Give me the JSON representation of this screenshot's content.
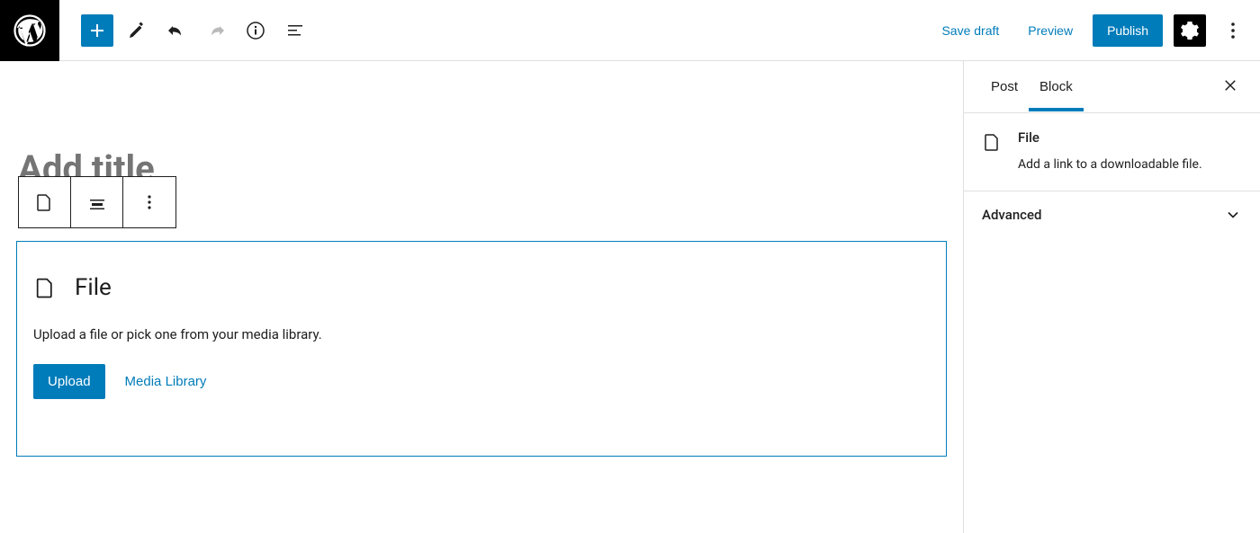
{
  "toolbar": {
    "save_draft": "Save draft",
    "preview": "Preview",
    "publish": "Publish"
  },
  "editor": {
    "title_placeholder": "Add title",
    "file_block": {
      "title": "File",
      "description": "Upload a file or pick one from your media library.",
      "upload_label": "Upload",
      "media_library_label": "Media Library"
    }
  },
  "sidebar": {
    "tabs": {
      "post": "Post",
      "block": "Block"
    },
    "active_tab": "block",
    "block": {
      "name": "File",
      "description": "Add a link to a downloadable file."
    },
    "advanced_label": "Advanced"
  },
  "colors": {
    "primary": "#007cba",
    "dark": "#000000"
  }
}
